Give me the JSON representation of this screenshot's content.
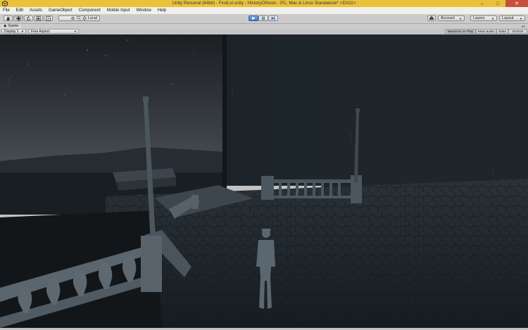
{
  "window": {
    "title": "Unity Personal (64bit) - FirstLvl.unity - HistoryOfAnon - PC, Mac & Linux Standalone* <DX11>",
    "minimize_glyph": "–",
    "maximize_glyph": "□",
    "close_glyph": "✕"
  },
  "menu": {
    "items": [
      {
        "label": "File"
      },
      {
        "label": "Edit"
      },
      {
        "label": "Assets"
      },
      {
        "label": "GameObject"
      },
      {
        "label": "Component"
      },
      {
        "label": "Mobile Input"
      },
      {
        "label": "Window"
      },
      {
        "label": "Help"
      }
    ]
  },
  "toolbar": {
    "pivot_label": "Center",
    "space_label": "Local",
    "account_label": "Account",
    "layers_label": "Layers",
    "layout_label": "Layout",
    "play_active": true,
    "accent": "#3b79d4"
  },
  "game_tab": {
    "label": "Game",
    "corner_hint": "▾≡"
  },
  "game_bar": {
    "display_label": "Display 1",
    "aspect_label": "Free Aspect",
    "maximize_on_play": "Maximize on Play",
    "mute_audio": "Mute audio",
    "stats": "Stats",
    "gizmos": "Gizmos"
  }
}
